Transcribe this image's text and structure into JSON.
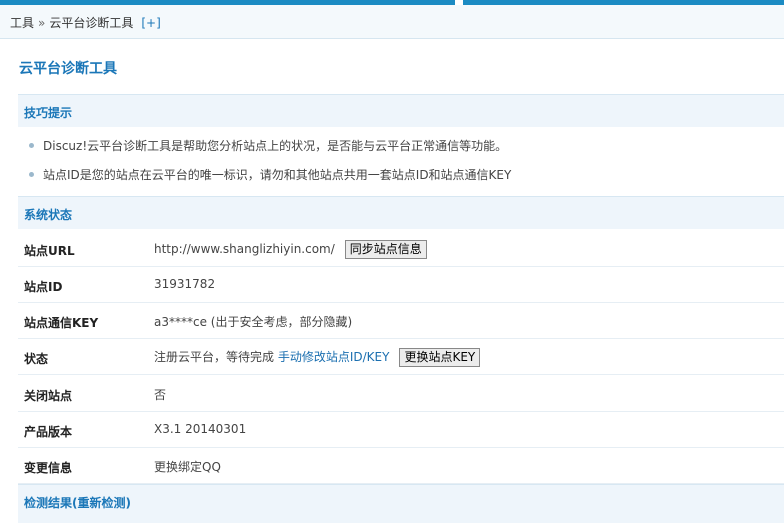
{
  "breadcrumb": {
    "root": "工具",
    "separator": "»",
    "current": "云平台诊断工具",
    "expand": "[+]"
  },
  "page_title": "云平台诊断工具",
  "tips": {
    "heading": "技巧提示",
    "items": [
      "Discuz!云平台诊断工具是帮助您分析站点上的状况，是否能与云平台正常通信等功能。",
      "站点ID是您的站点在云平台的唯一标识，请勿和其他站点共用一套站点ID和站点通信KEY"
    ]
  },
  "system_status": {
    "heading": "系统状态",
    "rows": [
      {
        "label": "站点URL",
        "value": "http://www.shanglizhiyin.com/",
        "button": "同步站点信息"
      },
      {
        "label": "站点ID",
        "value": "31931782"
      },
      {
        "label": "站点通信KEY",
        "value": "a3****ce (出于安全考虑，部分隐藏)"
      },
      {
        "label": "状态",
        "value": "注册云平台，等待完成",
        "link": "手动修改站点ID/KEY",
        "button": "更换站点KEY"
      },
      {
        "label": "关闭站点",
        "value": "否"
      },
      {
        "label": "产品版本",
        "value": "X3.1 20140301"
      },
      {
        "label": "变更信息",
        "link": "更换绑定QQ"
      }
    ]
  },
  "check_results": {
    "heading": "检测结果(重新检测)"
  },
  "colors": {
    "accent": "#1b77b8",
    "section_bg": "#eef5fb",
    "top_bar": "#1b8bc3"
  }
}
